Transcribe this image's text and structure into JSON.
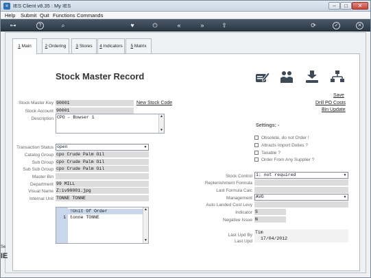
{
  "window": {
    "title": "IES Client v8.35 : My IES",
    "min": "–",
    "max": "□",
    "close": "✕"
  },
  "menu": [
    "Help",
    "Submit",
    "Quit",
    "Functions",
    "Commands"
  ],
  "toolbar": {
    "key": "⊶",
    "help": "?",
    "search": "⌕",
    "heart": "♥",
    "power": "⏻",
    "back": "«",
    "forward": "»",
    "upload": "⇧",
    "refresh": "⟳",
    "ok": "✓",
    "close": "✕"
  },
  "tabs": [
    {
      "u": "1",
      "label": " Main"
    },
    {
      "u": "2",
      "label": " Ordering"
    },
    {
      "u": "3",
      "label": " Stores"
    },
    {
      "u": "4",
      "label": " Indicators"
    },
    {
      "u": "5",
      "label": " Matrix"
    }
  ],
  "heading": "Stock Master Record",
  "icons": [
    "edit-document-icon",
    "users-icon",
    "download-tray-icon",
    "hierarchy-icon"
  ],
  "links": {
    "save": "Save",
    "drill": "Drill PO Costs",
    "bin": "Bin Update",
    "new_stock": "New Stock Code"
  },
  "fields": {
    "stock_master_key": {
      "label": "Stock Master Key",
      "value": "90001"
    },
    "stock_account": {
      "label": "Stock Account",
      "value": "90001"
    },
    "description": {
      "label": "Description",
      "value": "CPO - Bowser 1"
    },
    "transaction_status": {
      "label": "Transaction Status",
      "value": "open"
    },
    "catalog_group": {
      "label": "Catalog Group",
      "value": "cpo Crude Palm Oil"
    },
    "sub_group": {
      "label": "Sub Group",
      "value": "cpo Crude Palm Oil"
    },
    "sub_sub_group": {
      "label": "Sub Sub Group",
      "value": "cpo Crude Palm Oil"
    },
    "master_bin": {
      "label": "Master Bin",
      "value": ""
    },
    "department": {
      "label": "Department",
      "value": "99 MILL"
    },
    "visual_name": {
      "label": "Visual Name",
      "value": "Z:iv90001.jpg"
    },
    "internal_unit": {
      "label": "Internal Unit",
      "value": "TONNE TONNE"
    }
  },
  "settings": {
    "title": "Settings: -",
    "checks": [
      "Obsolete, do not Order !",
      "Attracts Import Duties ?",
      "Taxable ?",
      "Order From Any Supplier ?"
    ]
  },
  "right_fields": {
    "stock_control": {
      "label": "Stock Control",
      "value": "1: not required"
    },
    "replenishment": {
      "label": "Replenishment Formula",
      "value": ""
    },
    "last_formula": {
      "label": "Last Formula Calc",
      "value": ""
    },
    "management": {
      "label": "Management",
      "value": "AVG"
    },
    "auto_landed": {
      "label": "Auto Landed Cost Levy",
      "value": ""
    },
    "indicator": {
      "label": "Indicator",
      "value": "S"
    },
    "negative_issue": {
      "label": "Negative Issue",
      "value": "N"
    },
    "last_upd_by": {
      "label": "Last Upd By",
      "value": "Tim"
    },
    "last_upd": {
      "label": "Last Upd",
      "value": "17/04/2012"
    }
  },
  "unit_list": {
    "header": "!Unit Of Order",
    "rows": [
      {
        "n": "1",
        "t": "tonne TONNE"
      }
    ]
  },
  "edge": {
    "line1": "Se",
    "line2": "IE"
  }
}
